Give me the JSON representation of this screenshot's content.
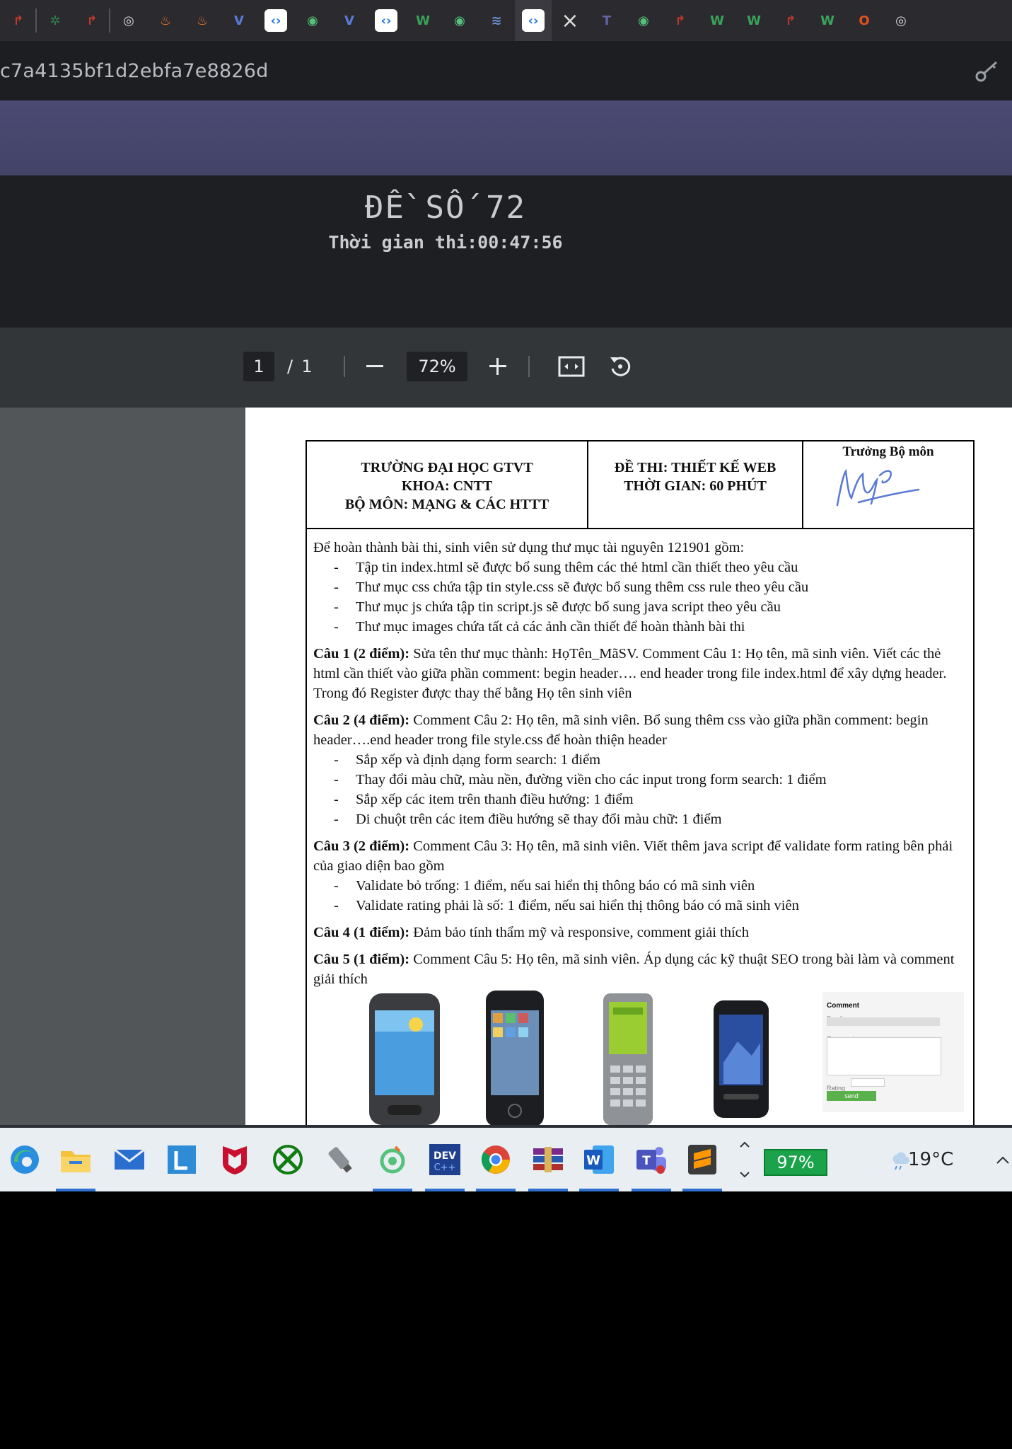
{
  "browser": {
    "tabs": [
      {
        "icon": "red-arrow-icon",
        "color": "#c0392b"
      },
      {
        "icon": "green-plant-icon",
        "color": "#2f7d4f"
      },
      {
        "icon": "red-arrow-icon",
        "color": "#c0392b"
      },
      {
        "icon": "swirl-icon",
        "color": "#d8d8d8"
      },
      {
        "icon": "fire-icon",
        "color": "#e8732a"
      },
      {
        "icon": "fire-icon",
        "color": "#e8732a"
      },
      {
        "icon": "v-logo-icon",
        "color": "#5a7bd8"
      },
      {
        "icon": "code-icon",
        "color": "#ffffff"
      },
      {
        "icon": "green-swirl-icon",
        "color": "#54c27a"
      },
      {
        "icon": "v-logo-icon",
        "color": "#5a7bd8"
      },
      {
        "icon": "code-icon",
        "color": "#ffffff"
      },
      {
        "icon": "w-logo-icon",
        "color": "#3aa35b"
      },
      {
        "icon": "green-swirl-icon",
        "color": "#54c27a"
      },
      {
        "icon": "stack-icon",
        "color": "#6c8fd4"
      },
      {
        "icon": "code-icon",
        "color": "#ffffff",
        "active": true
      },
      {
        "icon": "teams-icon",
        "color": "#6264a7"
      },
      {
        "icon": "green-swirl-icon",
        "color": "#54c27a"
      },
      {
        "icon": "red-arrow-icon",
        "color": "#c0392b"
      },
      {
        "icon": "w-logo-icon",
        "color": "#3aa35b"
      },
      {
        "icon": "w-logo-icon",
        "color": "#3aa35b"
      },
      {
        "icon": "red-arrow-icon",
        "color": "#c0392b"
      },
      {
        "icon": "w-logo-icon",
        "color": "#3aa35b"
      },
      {
        "icon": "office-icon",
        "color": "#e3501f"
      },
      {
        "icon": "swirl-icon",
        "color": "#d8d8d8"
      }
    ],
    "url": "c7a4135bf1d2ebfa7e8826d"
  },
  "exam": {
    "title": "ĐỀ SỐ 72",
    "timer": "Thời gian thi:00:47:56"
  },
  "pdf_toolbar": {
    "current_page": "1",
    "separator": "/",
    "total_pages": "1",
    "zoom": "72%"
  },
  "document": {
    "header": {
      "school": "TRƯỜNG ĐẠI HỌC GTVT",
      "faculty": "KHOA: CNTT",
      "department": "BỘ MÔN: MẠNG & CÁC HTTT",
      "exam_name": "ĐỀ THI: THIẾT KẾ WEB",
      "duration": "THỜI GIAN: 60 PHÚT",
      "signer": "Trưởng Bộ môn"
    },
    "intro": "Để hoàn thành bài thi, sinh viên sử dụng thư mục tài nguyên 121901 gồm:",
    "intro_items": [
      "Tập tin index.html sẽ được bổ sung thêm các thẻ html cần thiết theo yêu cầu",
      "Thư mục css chứa tập tin style.css sẽ được bổ sung thêm css rule theo yêu cầu",
      "Thư mục js chứa tập tin script.js sẽ được bổ sung java script theo yêu cầu",
      "Thư mục images chứa tất cả các ảnh cần thiết để hoàn thành bài thi"
    ],
    "q1_label": "Câu 1 (2 điểm):",
    "q1_text": " Sửa tên thư mục thành: HọTên_MãSV. Comment Câu 1: Họ tên, mã sinh viên. Viết các thẻ html cần thiết vào giữa phần comment: begin header…. end header trong file index.html để xây dựng header. Trong đó Register được thay thế bằng Họ tên sinh viên",
    "q2_label": "Câu 2 (4 điểm):",
    "q2_text": " Comment Câu 2: Họ tên, mã sinh viên. Bổ sung thêm css vào giữa phần comment: begin header….end header trong file style.css để hoàn thiện header",
    "q2_items": [
      "Sắp xếp và định dạng form search: 1 điểm",
      "Thay đổi màu chữ, màu nền, đường viền cho các input trong form search: 1 điểm",
      "Sắp xếp các item trên thanh điều hướng: 1 điểm",
      "Di chuột trên các item điều hướng sẽ thay đổi màu chữ: 1 điểm"
    ],
    "q3_label": "Câu 3 (2 điểm):",
    "q3_text": " Comment Câu 3: Họ tên, mã sinh viên. Viết thêm java script để validate form rating bên phải của giao diện bao gồm",
    "q3_items": [
      "Validate bỏ trống: 1 điểm,  nếu sai hiển thị thông báo có mã sinh viên",
      "Validate rating phải là số: 1 điểm,  nếu sai hiển thị thông báo có mã sinh viên"
    ],
    "q4_label": "Câu 4 (1 điểm):",
    "q4_text": " Đảm bảo tính thẩm mỹ và responsive, comment giải thích",
    "q5_label": "Câu 5 (1 điểm):",
    "q5_text": " Comment Câu 5: Họ tên, mã sinh viên. Áp dụng các kỹ thuật SEO trong bài làm và comment giải thích",
    "form_mock": {
      "title": "Comment",
      "email": "Email",
      "comment": "Comment",
      "rating": "Rating",
      "send": "send"
    }
  },
  "taskbar": {
    "battery": "97%",
    "temperature": "19°C"
  }
}
